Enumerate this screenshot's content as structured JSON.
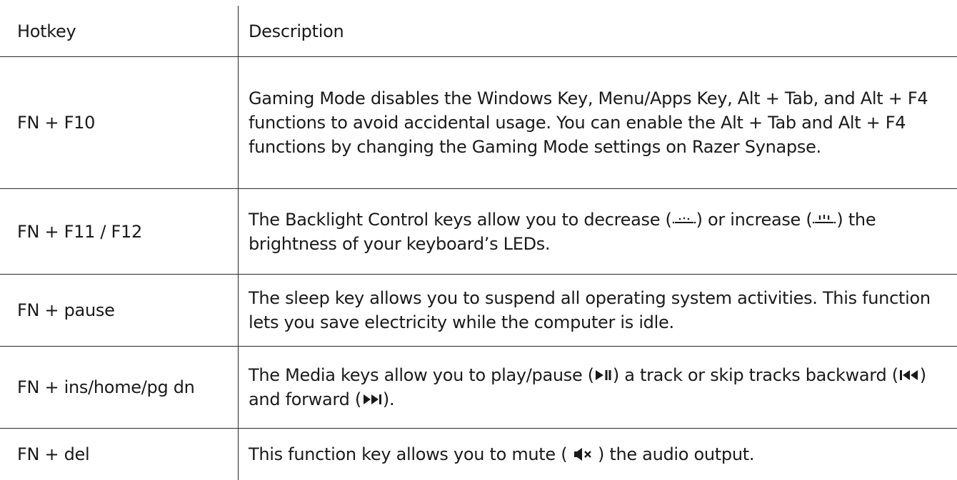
{
  "table": {
    "headers": {
      "hotkey": "Hotkey",
      "description": "Description"
    },
    "rows": [
      {
        "hotkey": "FN + F10",
        "description": "Gaming Mode disables the Windows Key, Menu/Apps Key, Alt + Tab, and Alt + F4 functions to avoid accidental usage. You can enable the Alt + Tab and Alt + F4 functions by changing the Gaming Mode settings on Razer Synapse."
      },
      {
        "hotkey": "FN + F11 / F12",
        "desc_part1": "The Backlight Control keys allow you to decrease (",
        "desc_part2": ") or increase (",
        "desc_part3": ") the brightness of your keyboard’s LEDs."
      },
      {
        "hotkey": "FN + pause",
        "description": "The sleep key allows you to suspend all operating system activities. This function lets you save electricity while the computer is idle."
      },
      {
        "hotkey": "FN + ins/home/pg dn",
        "desc_part1": "The Media keys allow you to play/pause (",
        "desc_part2": ") a track or skip tracks backward (",
        "desc_part3": ") and forward (",
        "desc_part4": ")."
      },
      {
        "hotkey": "FN + del",
        "desc_part1": "This function key allows you to mute (",
        "desc_part2": ") the audio output."
      }
    ]
  },
  "icons": {
    "brightness_down": "brightness-down-icon",
    "brightness_up": "brightness-up-icon",
    "play_pause": "play-pause-icon",
    "previous_track": "previous-track-icon",
    "next_track": "next-track-icon",
    "mute": "mute-icon"
  }
}
